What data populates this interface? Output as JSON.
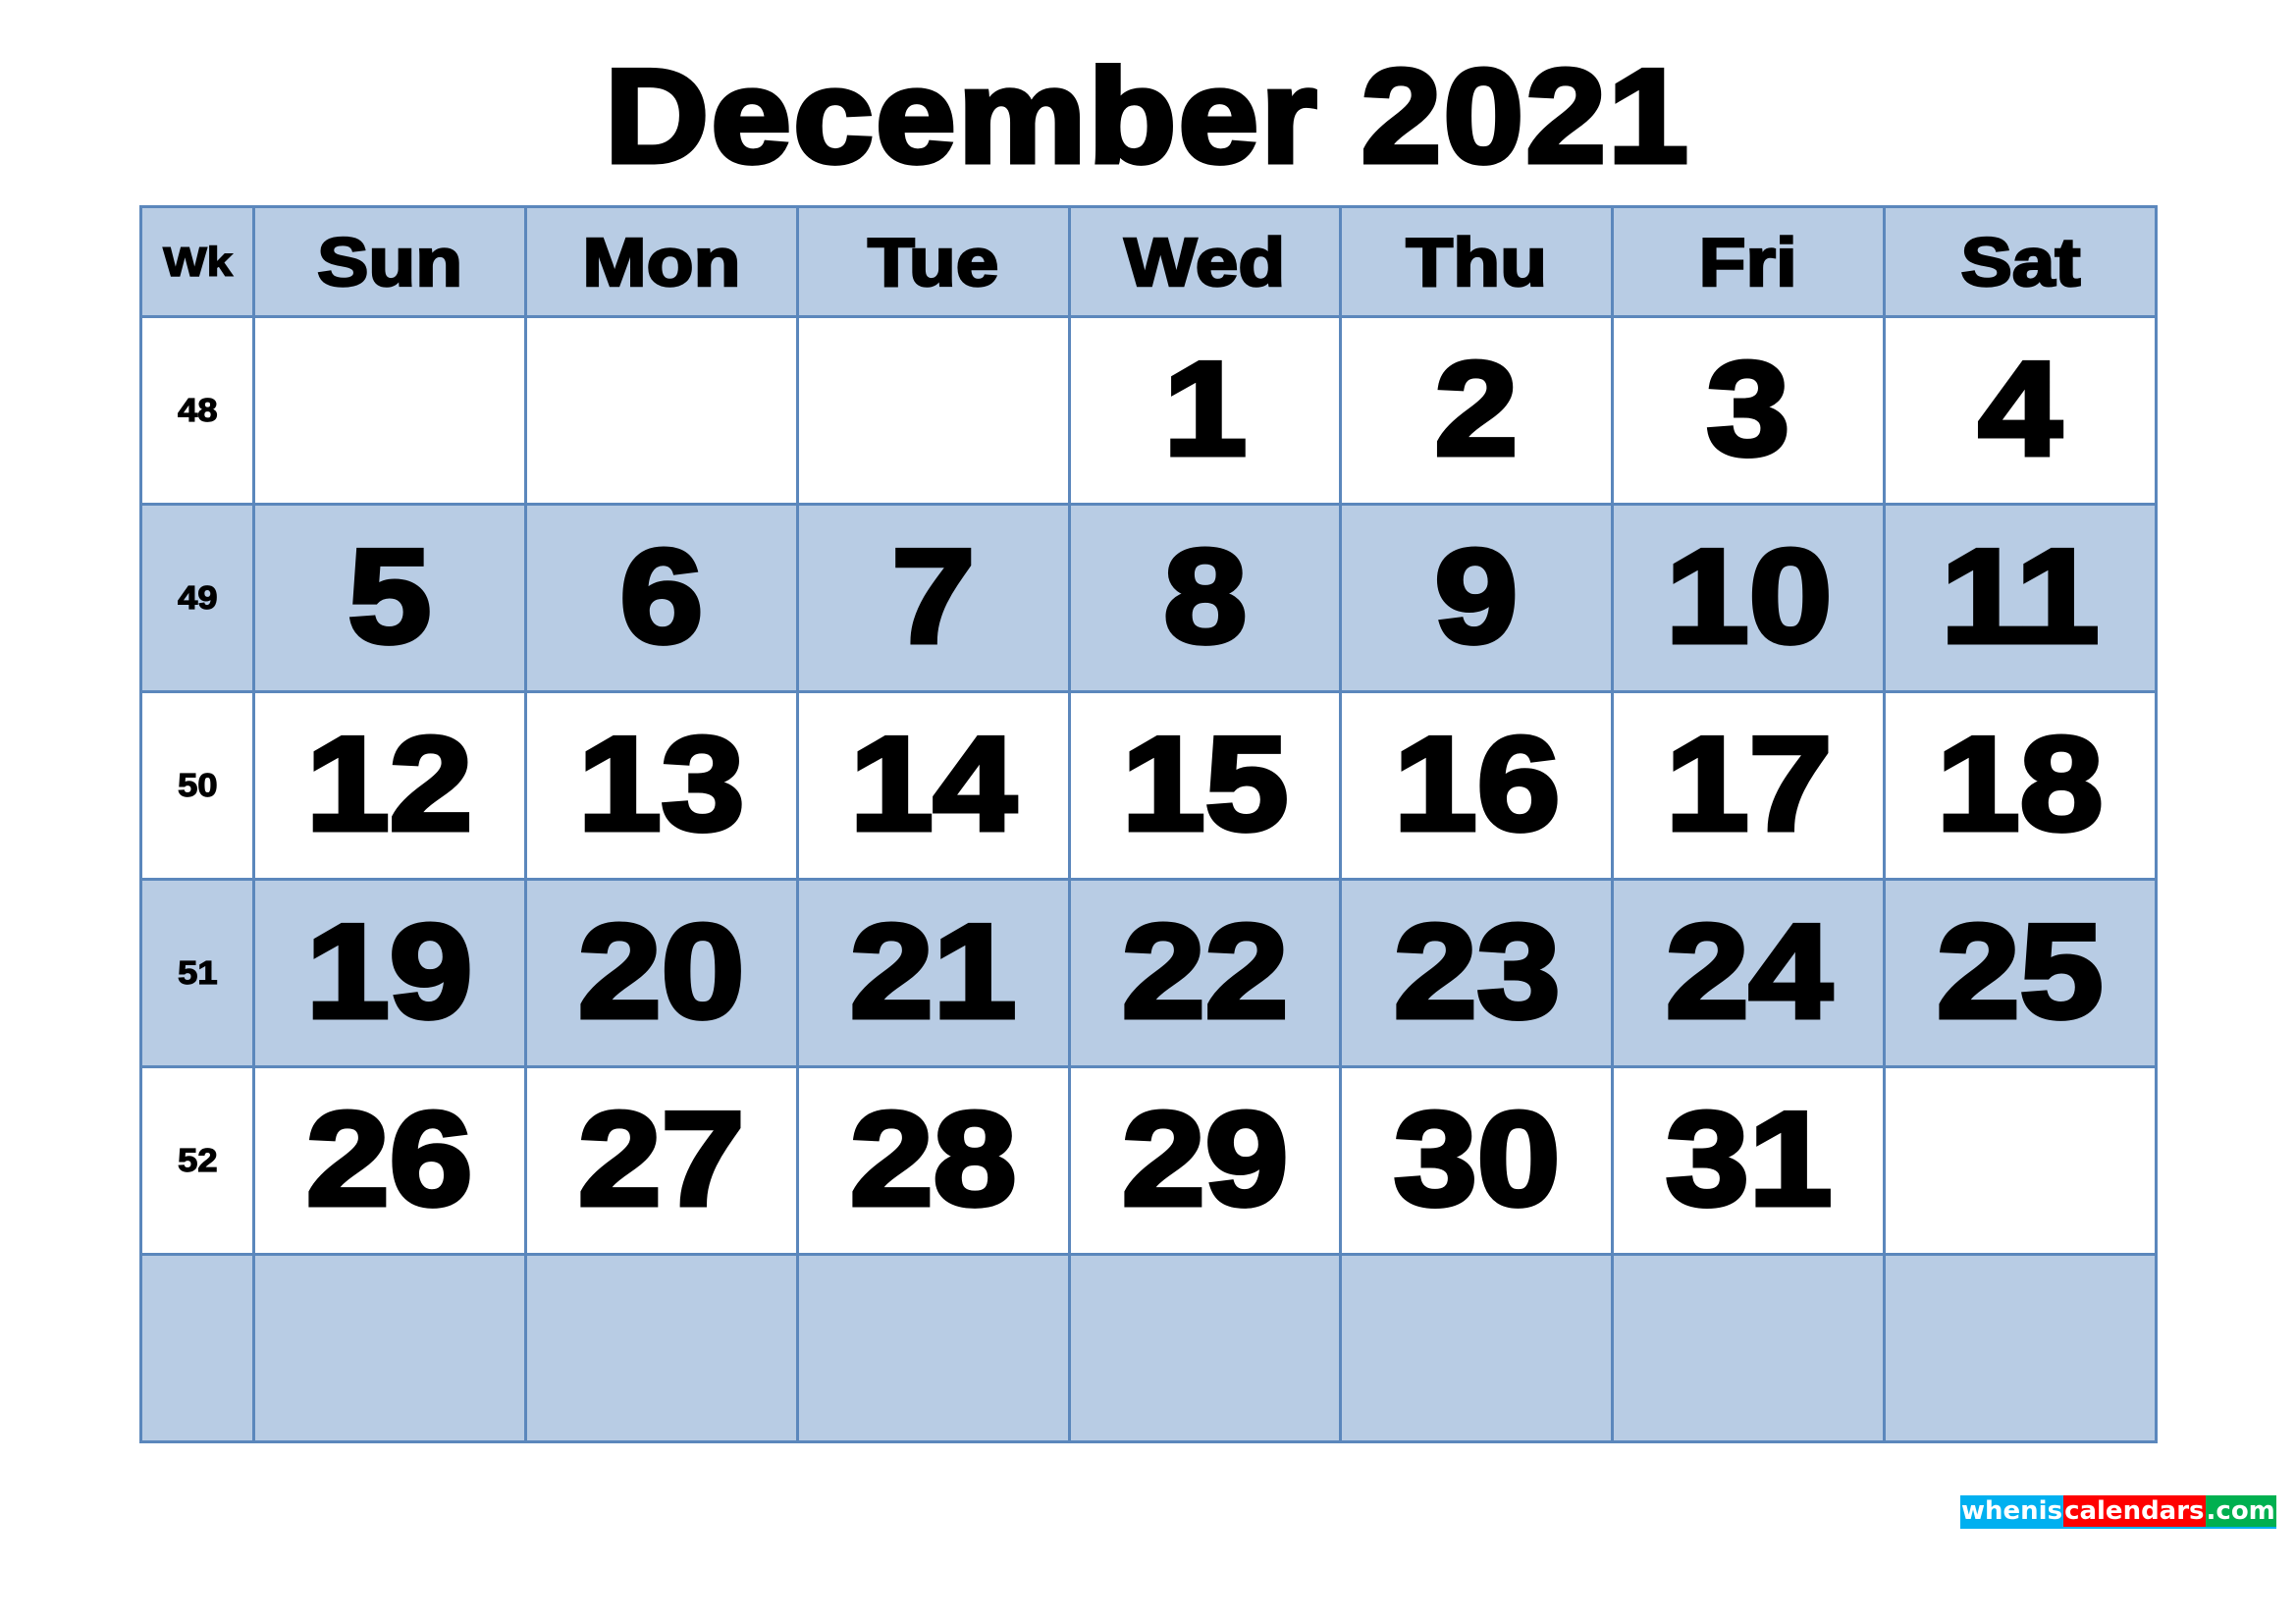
{
  "title": "December 2021",
  "header": {
    "week_label": "Wk",
    "days": [
      "Sun",
      "Mon",
      "Tue",
      "Wed",
      "Thu",
      "Fri",
      "Sat"
    ]
  },
  "weeks": [
    {
      "wk": "48",
      "days": [
        "",
        "",
        "",
        "1",
        "2",
        "3",
        "4"
      ]
    },
    {
      "wk": "49",
      "days": [
        "5",
        "6",
        "7",
        "8",
        "9",
        "10",
        "11"
      ]
    },
    {
      "wk": "50",
      "days": [
        "12",
        "13",
        "14",
        "15",
        "16",
        "17",
        "18"
      ]
    },
    {
      "wk": "51",
      "days": [
        "19",
        "20",
        "21",
        "22",
        "23",
        "24",
        "25"
      ]
    },
    {
      "wk": "52",
      "days": [
        "26",
        "27",
        "28",
        "29",
        "30",
        "31",
        ""
      ]
    },
    {
      "wk": "",
      "days": [
        "",
        "",
        "",
        "",
        "",
        "",
        ""
      ]
    }
  ],
  "logo": {
    "part1": "whenis",
    "part2": "calendars",
    "part3": ".com"
  },
  "colors": {
    "header_fill": "#b8cce4",
    "border": "#5b87bc",
    "logo_blue": "#00b0f0",
    "logo_red": "#ff0000",
    "logo_green": "#00b050"
  }
}
